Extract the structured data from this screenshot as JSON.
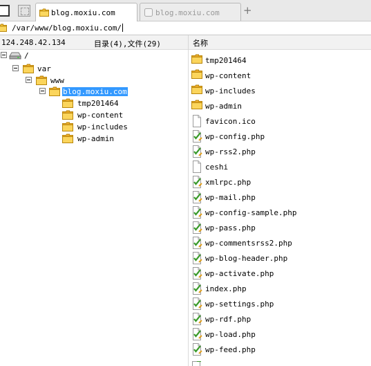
{
  "tabs": [
    {
      "title": "blog.moxiu.com",
      "active": true
    },
    {
      "title": "blog.moxiu.com",
      "active": false
    }
  ],
  "address": {
    "path": "/var/www/blog.moxiu.com/"
  },
  "header": {
    "host": "124.248.42.134",
    "counts": "目录(4),文件(29)",
    "name_column": "名称"
  },
  "tree": [
    {
      "label": "/",
      "icon": "drive-icon"
    },
    {
      "label": "var",
      "icon": "folder-icon"
    },
    {
      "label": "www",
      "icon": "folder-icon"
    },
    {
      "label": "blog.moxiu.com",
      "icon": "folder-icon",
      "selected": true
    },
    {
      "label": "tmp201464",
      "icon": "folder-icon"
    },
    {
      "label": "wp-content",
      "icon": "folder-icon"
    },
    {
      "label": "wp-includes",
      "icon": "folder-icon"
    },
    {
      "label": "wp-admin",
      "icon": "folder-icon"
    }
  ],
  "files": [
    {
      "name": "tmp201464",
      "icon": "folder-icon"
    },
    {
      "name": "wp-content",
      "icon": "folder-icon"
    },
    {
      "name": "wp-includes",
      "icon": "folder-icon"
    },
    {
      "name": "wp-admin",
      "icon": "folder-icon"
    },
    {
      "name": "favicon.ico",
      "icon": "file-icon"
    },
    {
      "name": "wp-config.php",
      "icon": "php-file-icon"
    },
    {
      "name": "wp-rss2.php",
      "icon": "php-file-icon"
    },
    {
      "name": "ceshi",
      "icon": "file-icon"
    },
    {
      "name": "xmlrpc.php",
      "icon": "php-file-icon"
    },
    {
      "name": "wp-mail.php",
      "icon": "php-file-icon"
    },
    {
      "name": "wp-config-sample.php",
      "icon": "php-file-icon"
    },
    {
      "name": "wp-pass.php",
      "icon": "php-file-icon"
    },
    {
      "name": "wp-commentsrss2.php",
      "icon": "php-file-icon"
    },
    {
      "name": "wp-blog-header.php",
      "icon": "php-file-icon"
    },
    {
      "name": "wp-activate.php",
      "icon": "php-file-icon"
    },
    {
      "name": "index.php",
      "icon": "php-file-icon"
    },
    {
      "name": "wp-settings.php",
      "icon": "php-file-icon"
    },
    {
      "name": "wp-rdf.php",
      "icon": "php-file-icon"
    },
    {
      "name": "wp-load.php",
      "icon": "php-file-icon"
    },
    {
      "name": "wp-feed.php",
      "icon": "php-file-icon"
    }
  ],
  "colors": {
    "selection": "#3399ff",
    "folder": "#f6c63a",
    "php_check": "#3a9a2a"
  }
}
